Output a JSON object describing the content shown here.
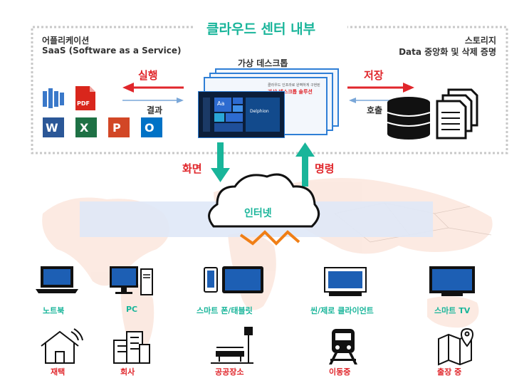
{
  "cloud_title": "클라우드 센터 내부",
  "application": {
    "heading": "어플리케이션",
    "subheading": "SaaS (Software as a Service)"
  },
  "storage": {
    "heading": "스토리지",
    "subheading": "Data 중앙화 및 삭제 증명"
  },
  "virtual_desktop": {
    "label": "가상 데스크톱",
    "slide_title": "가상 데스크톱 솔루션",
    "slide_caption": "클라우드 인프라로 완벽하게 구현된",
    "tile_text": "Aa",
    "slide_footer": "Delphion"
  },
  "flows": {
    "execute": "실행",
    "result": "결과",
    "store": "저장",
    "call": "호출",
    "screen": "화면",
    "command": "명령"
  },
  "internet_label": "인터넷",
  "app_icons": {
    "pdf_text": "PDF",
    "word": "W",
    "excel": "X",
    "ppt": "P",
    "outlook": "O"
  },
  "devices": [
    {
      "label": "노트북"
    },
    {
      "label": "PC"
    },
    {
      "label": "스마트 폰/태블릿"
    },
    {
      "label": "씬/제로 클라이언트"
    },
    {
      "label": "스마트 TV"
    }
  ],
  "locations": [
    {
      "label": "재택"
    },
    {
      "label": "회사"
    },
    {
      "label": "공공장소"
    },
    {
      "label": "이동중"
    },
    {
      "label": "출장 중"
    }
  ],
  "colors": {
    "accent_green": "#19b59a",
    "accent_red": "#e0262b",
    "dotted_border": "#c8c8c8",
    "band_blue": "#dfe8f7"
  }
}
